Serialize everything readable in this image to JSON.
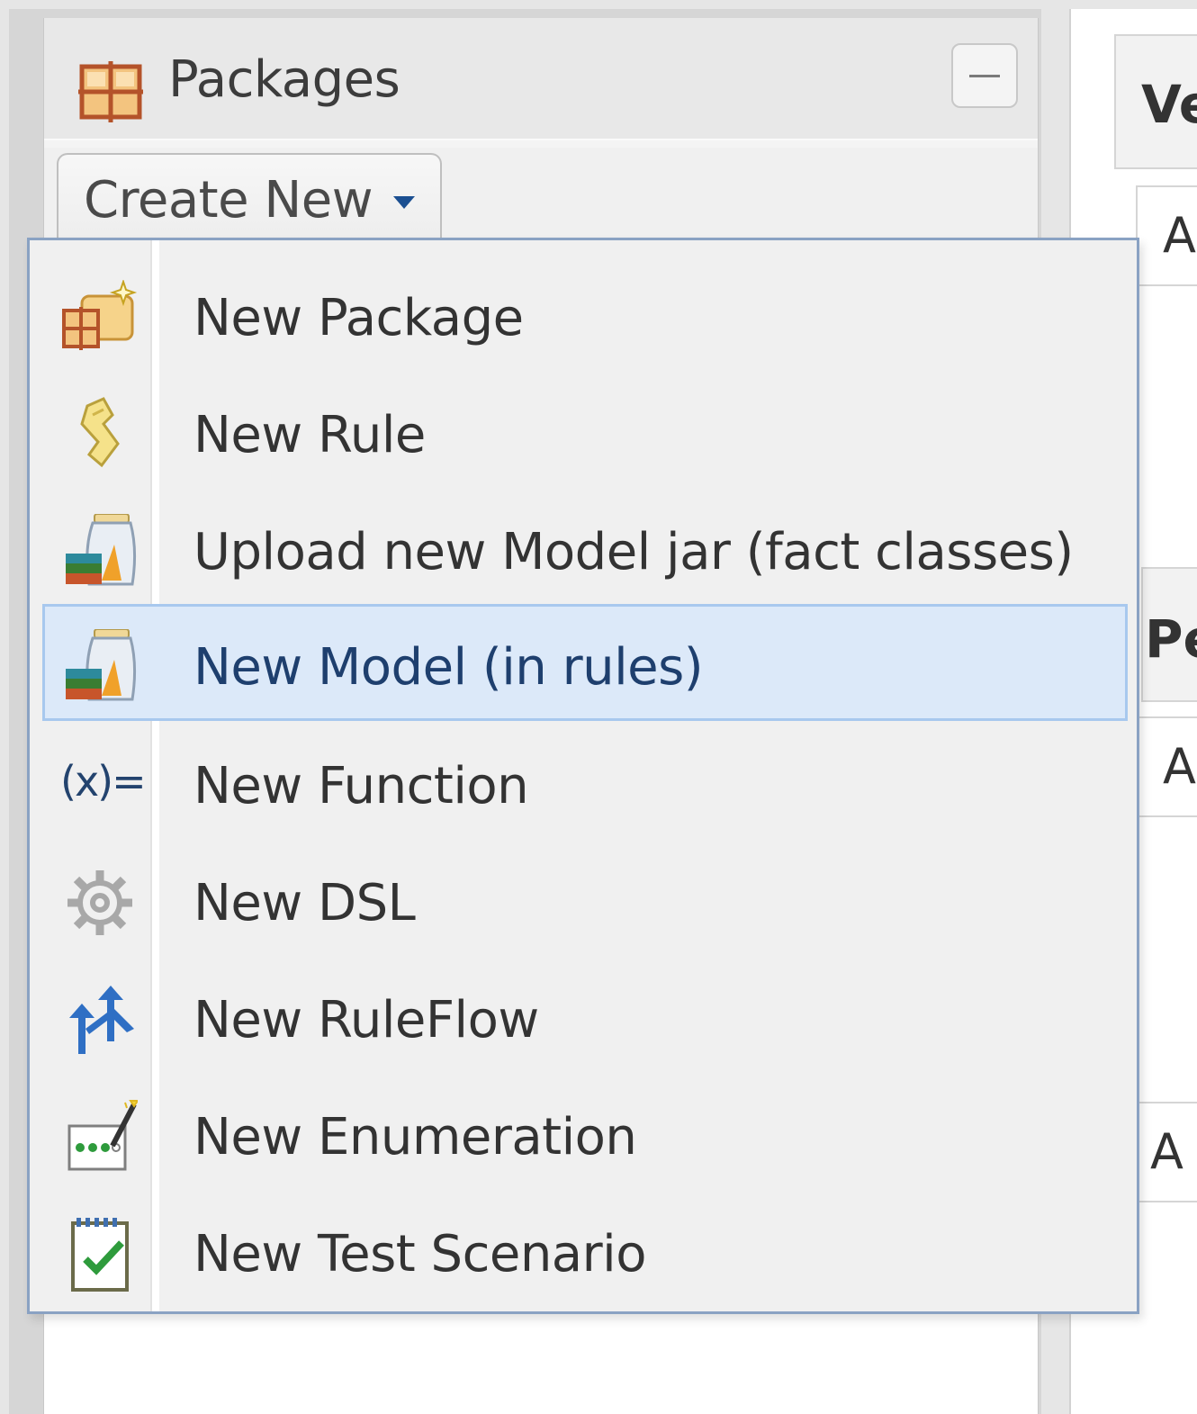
{
  "panel": {
    "title": "Packages",
    "create_new_label": "Create New"
  },
  "right_panel": {
    "header1": "Ve",
    "header2": "Pe",
    "field1": "A",
    "field2": "A",
    "field3": "A"
  },
  "menu": {
    "items": [
      {
        "label": "New Package",
        "icon": "new-package-icon"
      },
      {
        "label": "New Rule",
        "icon": "new-rule-icon"
      },
      {
        "label": "Upload new Model jar (fact classes)",
        "icon": "model-jar-icon"
      },
      {
        "label": "New Model (in rules)",
        "icon": "model-jar-icon",
        "selected": true
      },
      {
        "label": "New Function",
        "icon": "function-icon",
        "glyph": "(x)="
      },
      {
        "label": "New DSL",
        "icon": "gear-icon"
      },
      {
        "label": "New RuleFlow",
        "icon": "ruleflow-icon"
      },
      {
        "label": "New Enumeration",
        "icon": "enumeration-icon"
      },
      {
        "label": "New Test Scenario",
        "icon": "test-scenario-icon"
      }
    ]
  },
  "colors": {
    "menu_border": "#8aa2c3",
    "selected_bg": "#dce9f9",
    "selected_border": "#a8c8ee",
    "accent": "#1b4f91"
  }
}
